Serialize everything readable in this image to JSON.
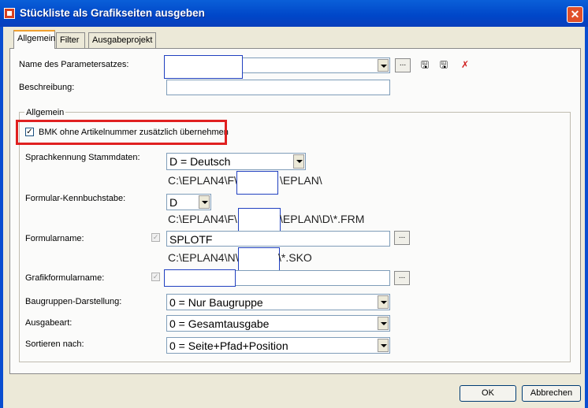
{
  "window": {
    "title": "Stückliste als Grafikseiten ausgeben",
    "close": "✕"
  },
  "tabs": [
    {
      "label": "Allgemein",
      "active": true
    },
    {
      "label": "Filter"
    },
    {
      "label": "Ausgabeprojekt"
    }
  ],
  "params": {
    "name_label": "Name des Parametersatzes:",
    "name_value": "",
    "browse": "...",
    "description_label": "Beschreibung:",
    "description_value": ""
  },
  "group": {
    "title": "Allgemein",
    "bmk_label": "BMK ohne Artikelnummer zusätzlich übernehmen",
    "bmk_checked": "✓",
    "lang_label": "Sprachkennung Stammdaten:",
    "lang_value": "D = Deutsch",
    "lang_path_a": "C:\\EPLAN4\\F\\",
    "lang_path_b": "\\EPLAN\\",
    "form_letter_label": "Formular-Kennbuchstabe:",
    "form_letter_value": "D",
    "form_path_a": "C:\\EPLAN4\\F\\",
    "form_path_b": "\\EPLAN\\D\\*.FRM",
    "formname_label": "Formularname:",
    "formname_value": "SPLOTF",
    "sko_path_a": "C:\\EPLAN4\\N\\",
    "sko_path_b": "\\*.SKO",
    "grafik_label": "Grafikformularname:",
    "grafik_value": "",
    "baugruppen_label": "Baugruppen-Darstellung:",
    "baugruppen_value": "0 = Nur Baugruppe",
    "ausgabeart_label": "Ausgabeart:",
    "ausgabeart_value": "0 = Gesamtausgabe",
    "sort_label": "Sortieren nach:",
    "sort_value": "0 = Seite+Pfad+Position",
    "browse": "..."
  },
  "buttons": {
    "ok": "OK",
    "cancel": "Abbrechen"
  }
}
